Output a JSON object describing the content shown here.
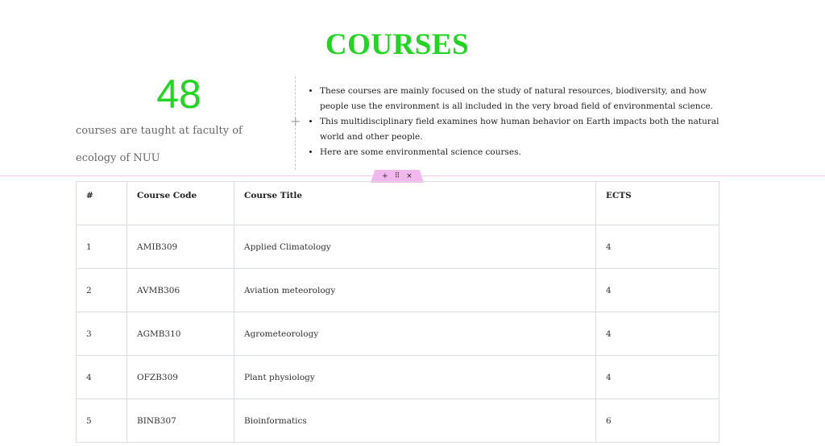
{
  "page": {
    "title": "COURSES"
  },
  "counter": {
    "number": "48",
    "description": "courses are taught at faculty of ecology of NUU"
  },
  "bullets": [
    "These courses are mainly focused on the study of natural resources, biodiversity, and how people use the environment is all included in the very broad field of environmental science.",
    "This multidisciplinary field examines how human behavior on Earth impacts both the natural world and other people.",
    "Here are some environmental science courses."
  ],
  "editor": {
    "add_icon": "+",
    "drag_icon": "⠿",
    "close_icon": "×"
  },
  "table": {
    "headers": [
      "#",
      "Course Code",
      "Course Title",
      "ECTS"
    ],
    "rows": [
      [
        "1",
        "AMIB309",
        "Applied Climatology",
        "4"
      ],
      [
        "2",
        "AVMB306",
        "Aviation meteorology",
        "4"
      ],
      [
        "3",
        "AGMB310",
        "Agrometeorology",
        "4"
      ],
      [
        "4",
        "OFZB309",
        "Plant physiology",
        "4"
      ],
      [
        "5",
        "BINB307",
        "Bioinformatics",
        "6"
      ]
    ]
  },
  "colors": {
    "accent_green": "#20d620",
    "section_handle": "#f2b8ee"
  }
}
